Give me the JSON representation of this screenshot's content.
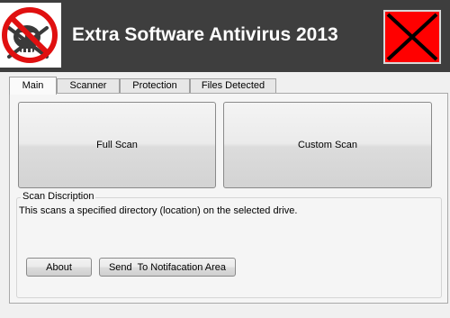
{
  "header": {
    "title": "Extra Software Antivirus 2013",
    "logo_icon": "no-pirate-skull-icon",
    "close_icon": "close-x-icon",
    "background": "#3e3e3e",
    "close_color": "#ff0000"
  },
  "tabs": [
    {
      "label": "Main",
      "active": true
    },
    {
      "label": "Scanner",
      "active": false
    },
    {
      "label": "Protection",
      "active": false
    },
    {
      "label": "Files Detected",
      "active": false
    }
  ],
  "main": {
    "full_scan_label": "Full Scan",
    "custom_scan_label": "Custom Scan",
    "scan_description": {
      "caption": "Scan Discription",
      "text": "This scans a specified directory (location) on the selected drive."
    },
    "about_label": "About",
    "notify_label": "Send  To Notifacation Area"
  }
}
